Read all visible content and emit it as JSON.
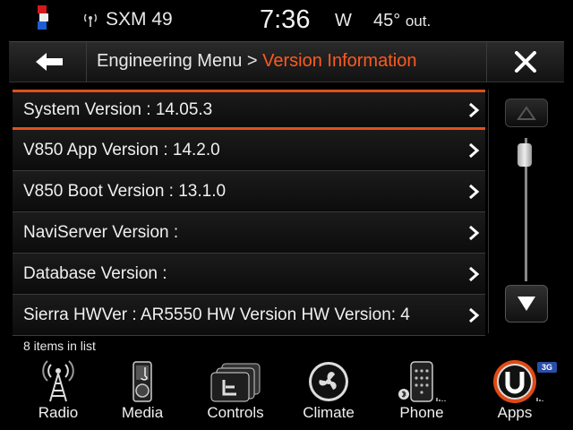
{
  "status": {
    "radio_station": "SXM 49",
    "time": "7:36",
    "compass": "W",
    "temperature": "45°",
    "temperature_suffix": "out."
  },
  "titlebar": {
    "breadcrumb_parent": "Engineering Menu >",
    "breadcrumb_current": "Version Information",
    "back_icon": "back-arrow-icon",
    "close_icon": "close-icon"
  },
  "list": {
    "items": [
      {
        "label": "System Version :  14.05.3"
      },
      {
        "label": "V850 App Version :  14.2.0"
      },
      {
        "label": "V850 Boot Version :  13.1.0"
      },
      {
        "label": "NaviServer Version :"
      },
      {
        "label": "Database Version :"
      },
      {
        "label": "Sierra HWVer :  AR5550 HW Version HW Version: 4"
      }
    ],
    "count_text": "8 items in list"
  },
  "nav": {
    "items": [
      {
        "label": "Radio",
        "icon": "radio-tower-icon"
      },
      {
        "label": "Media",
        "icon": "media-player-icon"
      },
      {
        "label": "Controls",
        "icon": "seat-controls-icon"
      },
      {
        "label": "Climate",
        "icon": "climate-fan-icon"
      },
      {
        "label": "Phone",
        "icon": "phone-icon"
      },
      {
        "label": "Apps",
        "icon": "uconnect-apps-icon"
      }
    ],
    "apps_badge": "3G"
  },
  "colors": {
    "accent": "#ff5a1e",
    "selection": "#e2501c",
    "background": "#000000"
  }
}
